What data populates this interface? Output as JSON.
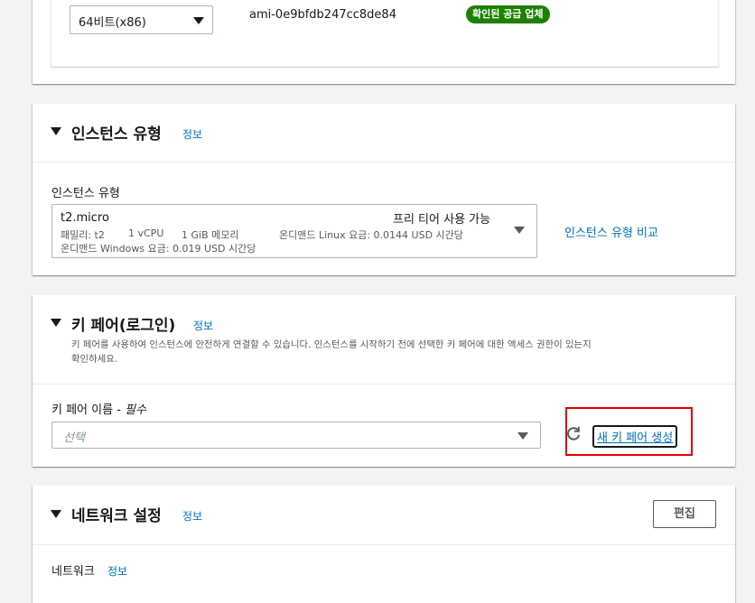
{
  "ami": {
    "arch_select": "64비트(x86)",
    "ami_id": "ami-0e9bfdb247cc8de84",
    "verified_badge": "확인된 공급 업체"
  },
  "instance_type": {
    "title": "인스턴스 유형",
    "info": "정보",
    "field_label": "인스턴스 유형",
    "selected_type": "t2.micro",
    "free_tier": "프리 티어 사용 가능",
    "specs": [
      "패밀리: t2",
      "1 vCPU",
      "1 GiB 메모리",
      "온디맨드 Linux 요금: 0.0144 USD 시간당"
    ],
    "windows_price": "온디맨드 Windows 요금: 0.019 USD 시간당",
    "compare_link": "인스턴스 유형 비교"
  },
  "key_pair": {
    "title": "키 페어(로그인)",
    "info": "정보",
    "description_line1": "키 페어를 사용하여 인스턴스에 안전하게 연결할 수 있습니다. 인스턴스를 시작하기 전에 선택한 키 페어에 대한 액세스 권한이 있는지",
    "description_line2": "확인하세요.",
    "field_label": "키 페어 이름 - ",
    "required": "필수",
    "placeholder": "선택",
    "create_link": "새 키 페어 생성"
  },
  "network": {
    "title": "네트워크 설정",
    "info": "정보",
    "edit_button": "편집",
    "field_label": "네트워크",
    "field_info": "정보"
  },
  "colors": {
    "link": "#0073bb",
    "badge_green": "#1d8102",
    "highlight_red": "#e00000",
    "background": "#f2f3f3"
  }
}
